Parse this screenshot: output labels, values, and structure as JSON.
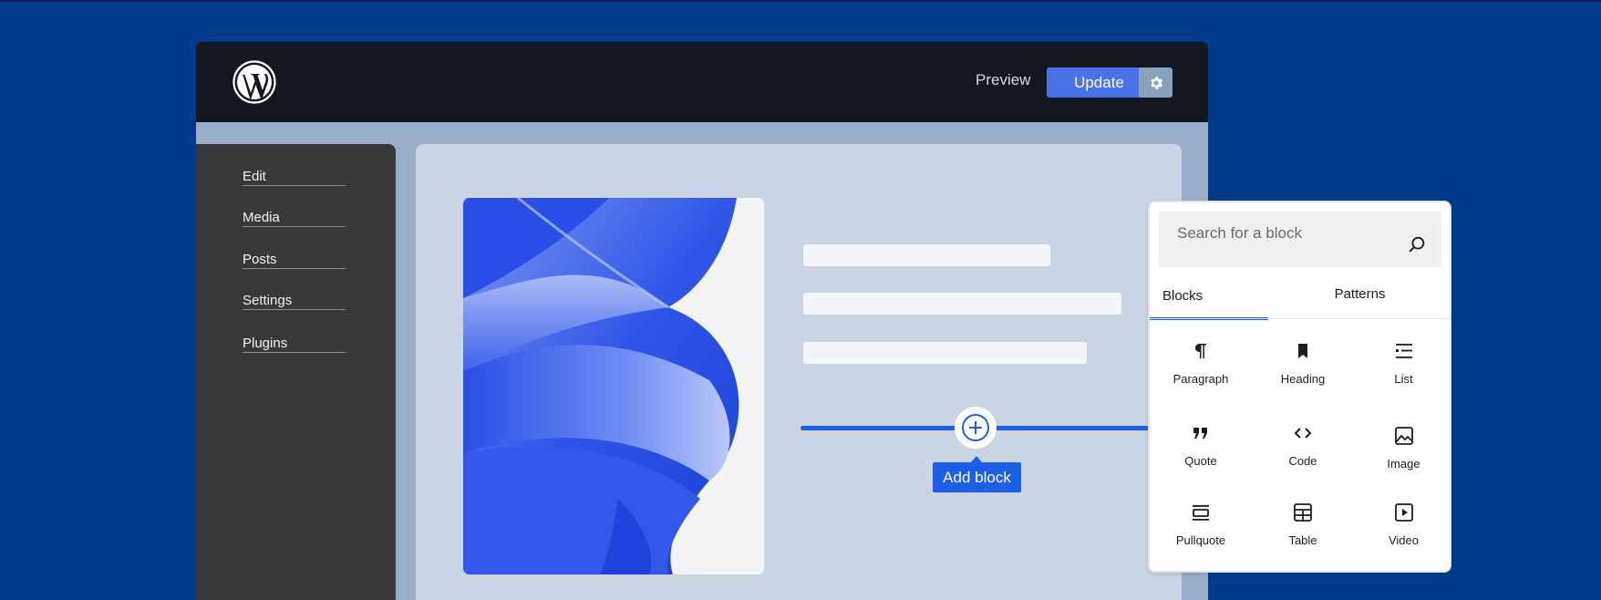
{
  "topbar": {
    "logo_icon": "wordpress-logo-icon",
    "preview_label": "Preview",
    "update_label": "Update",
    "settings_icon": "gear-icon"
  },
  "sidebar": {
    "items": [
      {
        "label": "Edit"
      },
      {
        "label": "Media"
      },
      {
        "label": "Posts"
      },
      {
        "label": "Settings"
      },
      {
        "label": "Plugins"
      }
    ]
  },
  "canvas": {
    "add_block_icon": "plus-circle-icon",
    "add_block_label": "Add block"
  },
  "inserter": {
    "search_placeholder": "Search for a block",
    "search_icon": "search-icon",
    "tabs": [
      {
        "label": "Blocks",
        "active": true
      },
      {
        "label": "Patterns",
        "active": false
      }
    ],
    "blocks": [
      {
        "label": "Paragraph",
        "icon": "paragraph-icon"
      },
      {
        "label": "Heading",
        "icon": "heading-bookmark-icon"
      },
      {
        "label": "List",
        "icon": "list-icon"
      },
      {
        "label": "Quote",
        "icon": "quote-icon"
      },
      {
        "label": "Code",
        "icon": "code-icon"
      },
      {
        "label": "Image",
        "icon": "image-icon"
      },
      {
        "label": "Pullquote",
        "icon": "pullquote-icon"
      },
      {
        "label": "Table",
        "icon": "table-icon"
      },
      {
        "label": "Video",
        "icon": "video-icon"
      }
    ]
  },
  "colors": {
    "background": "#003a8c",
    "accent": "#1d5fe8",
    "update_button": "#4a73ea",
    "topbar": "#13171f",
    "sidebar": "#38393b"
  }
}
